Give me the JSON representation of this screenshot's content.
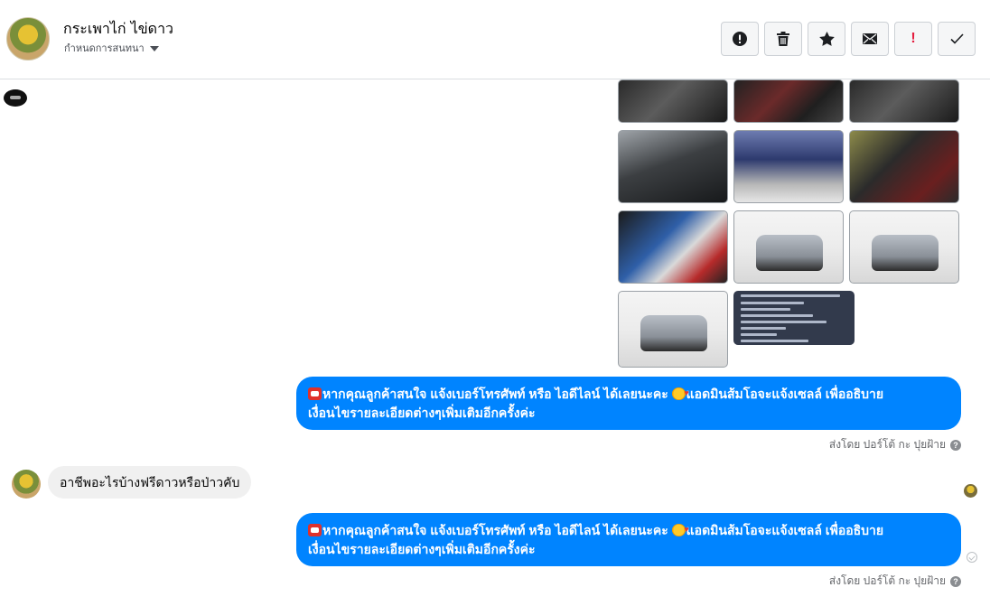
{
  "header": {
    "title": "กระเพาไก่ ไข่ดาว",
    "subtitle": "กำหนดการสนทนา",
    "actions": [
      {
        "name": "report-button",
        "icon": "exclamation-circle-icon"
      },
      {
        "name": "delete-button",
        "icon": "trash-icon"
      },
      {
        "name": "star-button",
        "icon": "star-icon"
      },
      {
        "name": "mark-unread-button",
        "icon": "envelope-icon"
      },
      {
        "name": "important-button",
        "icon": "exclamation-icon",
        "color": "#e41e3f"
      },
      {
        "name": "done-button",
        "icon": "checkmark-icon"
      }
    ]
  },
  "messages": {
    "outgoing_1": {
      "line1": "หากคุณลูกค้าสนใจ แจ้งเบอร์โทรศัพท์ หรือ ไอดีไลน์  ได้เลยนะคะ",
      "line1b": "แอดมินส้มโอจะแจ้งเซลล์   เพื่ออธิบาย",
      "line2": "เงื่อนไขรายละเอียดต่างๆเพิ่มเติมอีกครั้งค่ะ"
    },
    "sender_label_1": "ส่งโดย ปอร์โต้ กะ ปุยฝ้าย",
    "incoming_1": "อาชีพอะไรบ้างฟรีดาวหรือป่าวคับ",
    "outgoing_2": {
      "line1": "หากคุณลูกค้าสนใจ แจ้งเบอร์โทรศัพท์ หรือ ไอดีไลน์  ได้เลยนะคะ",
      "line1b": "แอดมินส้มโอจะแจ้งเซลล์   เพื่ออธิบาย",
      "line2": "เงื่อนไขรายละเอียดต่างๆเพิ่มเติมอีกครั้งค่ะ"
    },
    "sender_label_2": "ส่งโดย ปอร์โต้ กะ ปุยฝ้าย"
  },
  "colors": {
    "outgoing_bubble": "#0084ff",
    "incoming_bubble": "#f0f0f0",
    "important": "#e41e3f"
  }
}
